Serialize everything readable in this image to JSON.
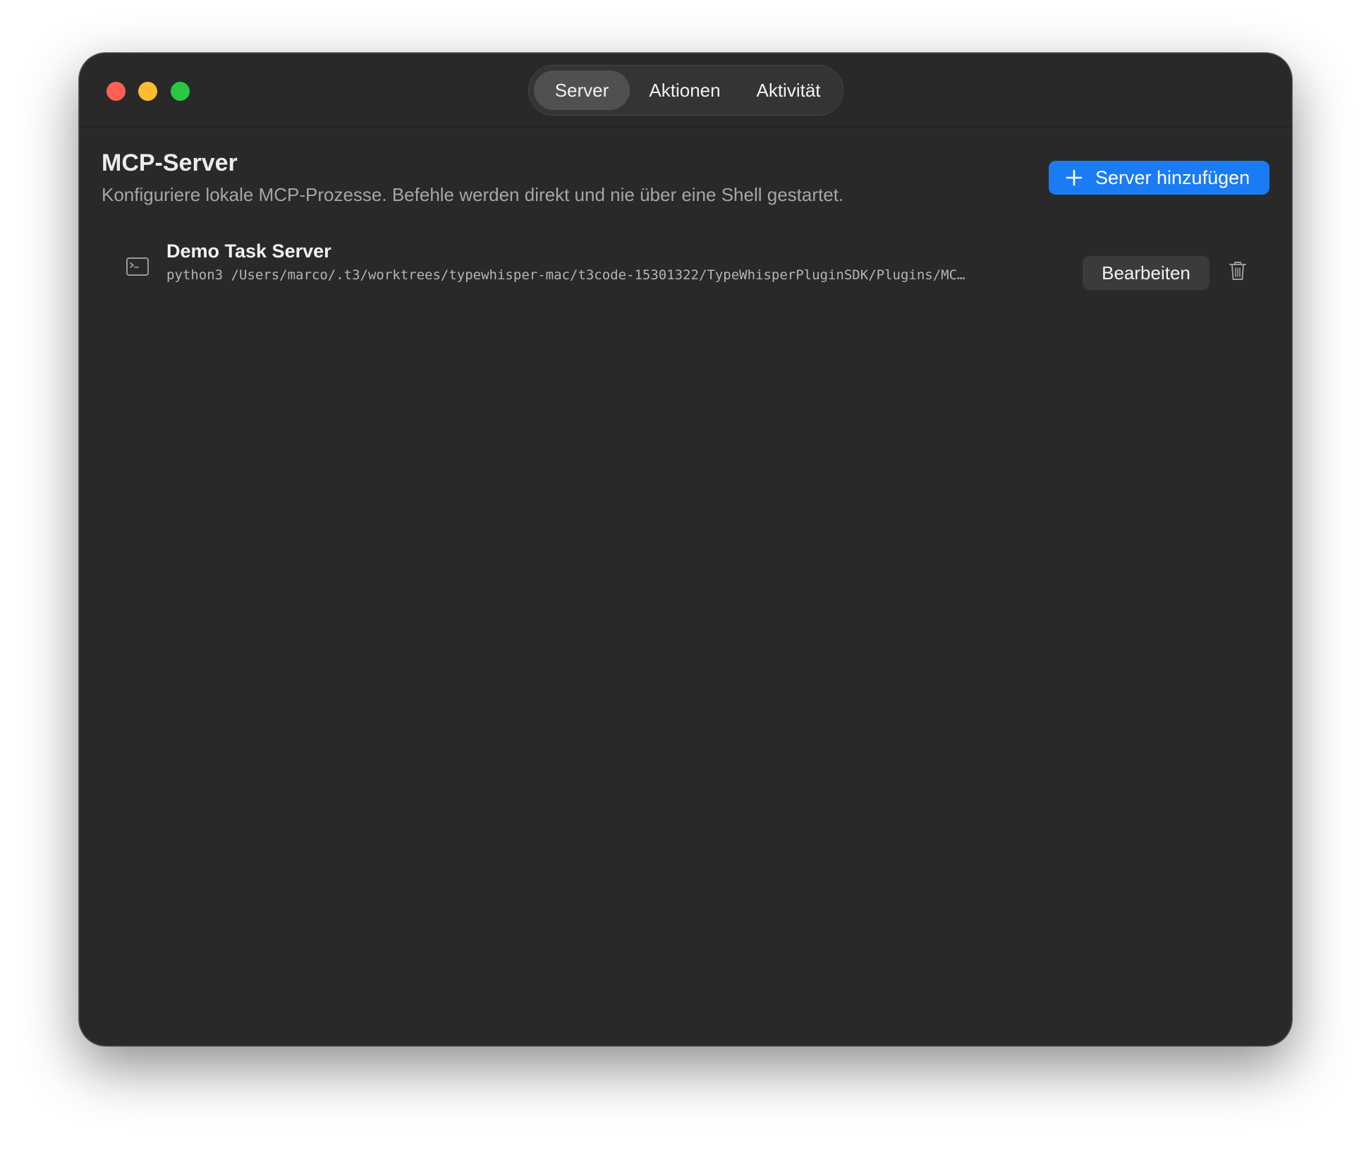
{
  "window": {
    "controls": [
      "close",
      "minimize",
      "zoom"
    ]
  },
  "tabs": [
    {
      "label": "Server",
      "active": true
    },
    {
      "label": "Aktionen",
      "active": false
    },
    {
      "label": "Aktivität",
      "active": false
    }
  ],
  "header": {
    "title": "MCP-Server",
    "subtitle": "Konfiguriere lokale MCP-Prozesse. Befehle werden direkt und nie über eine Shell gestartet.",
    "add_button_label": "Server hinzufügen",
    "add_button_icon": "plus-icon"
  },
  "servers": [
    {
      "name": "Demo Task Server",
      "command": "python3 /Users/marco/.t3/worktrees/typewhisper-mac/t3code-15301322/TypeWhisperPluginSDK/Plugins/MC…",
      "icon": "terminal-icon",
      "edit_label": "Bearbeiten",
      "delete_icon": "trash-icon"
    }
  ],
  "colors": {
    "window_bg": "#292929",
    "accent": "#1a7cf5",
    "close": "#ff5f57",
    "minimize": "#febc2e",
    "zoom": "#28c840"
  }
}
